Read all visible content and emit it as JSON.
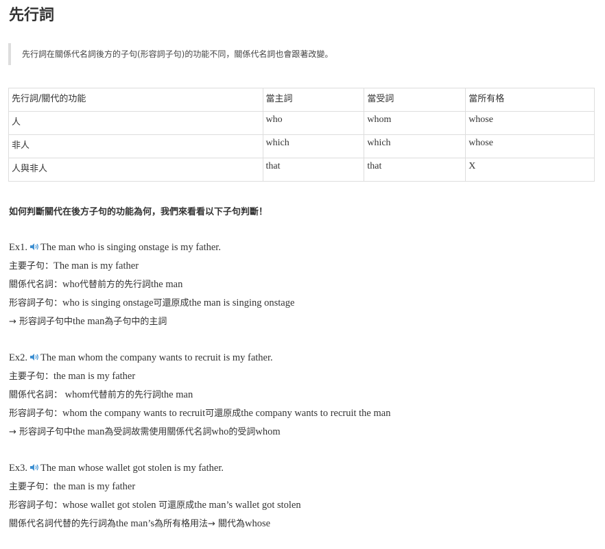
{
  "title": "先行詞",
  "quote": "先行詞在關係代名詞後方的子句(形容詞子句)的功能不同，關係代名詞也會跟著改變。",
  "table": {
    "headers": [
      "先行詞/關代的功能",
      "當主詞",
      "當受詞",
      "當所有格"
    ],
    "rows": [
      [
        "人",
        "who",
        "whom",
        "whose"
      ],
      [
        "非人",
        "which",
        "which",
        "whose"
      ],
      [
        "人與非人",
        "that",
        "that",
        "X"
      ]
    ]
  },
  "intro": "如何判斷關代在後方子句的功能為何，我們來看看以下子句判斷！",
  "examples": [
    {
      "label": "Ex1.",
      "sentence": "The man who is singing onstage is my father.",
      "main_prefix": "主要子句：",
      "main_text": "The man is my father",
      "rel_prefix": "關係代名詞：",
      "rel_a": "who",
      "rel_b": "代替前方的先行詞",
      "rel_c": "the man",
      "adj_prefix": "形容詞子句：",
      "adj_a": "who is singing onstage",
      "adj_b": "可還原成",
      "adj_c": "the man is singing onstage",
      "arrow_a": "→ 形容詞子句中",
      "arrow_b": "the man",
      "arrow_c": "為子句中的主詞"
    },
    {
      "label": "Ex2.",
      "sentence": "The man whom the company wants to recruit is my father.",
      "main_prefix": "主要子句：",
      "main_text": "the man is my father",
      "rel_prefix": "關係代名詞：",
      "rel_a": " whom",
      "rel_b": "代替前方的先行詞",
      "rel_c": "the man",
      "adj_prefix": "形容詞子句：",
      "adj_a": "whom the company wants to recruit",
      "adj_b": "可還原成",
      "adj_c": "the company wants to recruit the man",
      "arrow_a": "→ 形容詞子句中",
      "arrow_b": "the man",
      "arrow_c": "為受詞故需使用關係代名詞",
      "arrow_d": "who",
      "arrow_e": "的受詞",
      "arrow_f": "whom"
    },
    {
      "label": "Ex3.",
      "sentence": "The man whose wallet got stolen is my father.",
      "main_prefix": "主要子句：",
      "main_text": "the man is my father",
      "adj_prefix": "形容詞子句：",
      "adj_a": "whose wallet got stolen ",
      "adj_b": "可還原成",
      "adj_c": "the man’s wallet got stolen",
      "last_a": "關係代名詞代替的先行詞為",
      "last_b": "the man’s",
      "last_c": "為所有格用法→ 關代為",
      "last_d": "whose"
    }
  ],
  "colors": {
    "speaker": "#3d8fd1",
    "border": "#dddddd",
    "text": "#333333"
  },
  "icons": {
    "speaker": "speaker-icon"
  }
}
